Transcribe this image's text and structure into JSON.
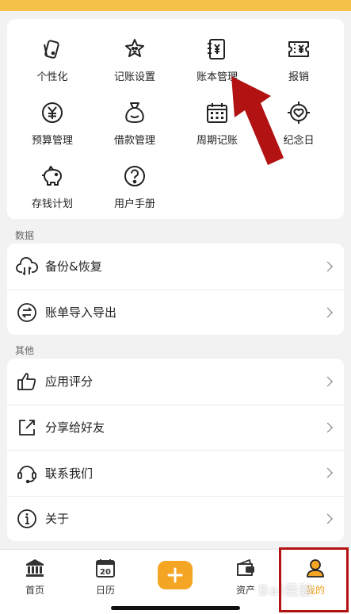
{
  "accent_color": "#f5a524",
  "grid": {
    "items": [
      {
        "label": "个性化",
        "icon": "palette-card-icon"
      },
      {
        "label": "记账设置",
        "icon": "star-settings-icon"
      },
      {
        "label": "账本管理",
        "icon": "ledger-book-icon"
      },
      {
        "label": "报销",
        "icon": "receipt-ticket-icon"
      },
      {
        "label": "预算管理",
        "icon": "yen-circle-icon"
      },
      {
        "label": "借款管理",
        "icon": "money-bag-icon"
      },
      {
        "label": "周期记账",
        "icon": "calendar-grid-icon"
      },
      {
        "label": "纪念日",
        "icon": "heart-target-icon"
      },
      {
        "label": "存钱计划",
        "icon": "piggy-bank-icon"
      },
      {
        "label": "用户手册",
        "icon": "question-circle-icon"
      }
    ]
  },
  "sections": {
    "data_label": "数据",
    "data_items": [
      {
        "label": "备份&恢复",
        "icon": "cloud-sync-icon"
      },
      {
        "label": "账单导入导出",
        "icon": "import-export-icon"
      }
    ],
    "other_label": "其他",
    "other_items": [
      {
        "label": "应用评分",
        "icon": "thumbs-up-icon"
      },
      {
        "label": "分享给好友",
        "icon": "share-icon"
      },
      {
        "label": "联系我们",
        "icon": "headset-icon"
      },
      {
        "label": "关于",
        "icon": "info-icon"
      }
    ]
  },
  "tabbar": {
    "home": "首页",
    "calendar": "日历",
    "calendar_day": "20",
    "assets": "资产",
    "mine": "我的",
    "active_tab": "mine"
  },
  "watermark": "Bai经验"
}
